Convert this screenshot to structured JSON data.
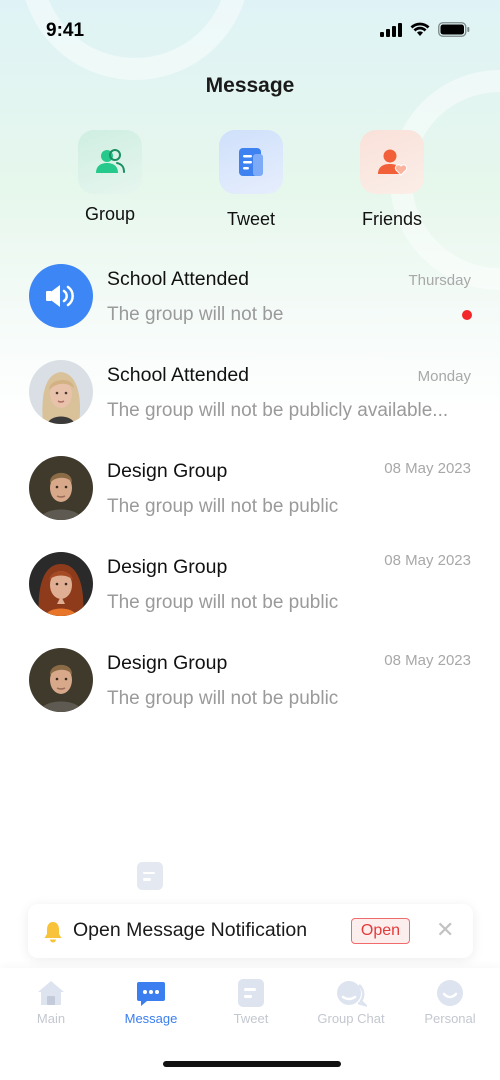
{
  "status": {
    "time": "9:41"
  },
  "header": {
    "title": "Message"
  },
  "quick_actions": [
    {
      "label": "Group",
      "icon": "group-icon",
      "color": "#2ecf8e"
    },
    {
      "label": "Tweet",
      "icon": "document-icon",
      "color": "#4a8af4"
    },
    {
      "label": "Friends",
      "icon": "friend-heart-icon",
      "color": "#f46a4a"
    }
  ],
  "messages": [
    {
      "name": "School Attended",
      "preview": "The group will not be",
      "time": "Thursday",
      "unread": true,
      "avatar": "speaker-icon"
    },
    {
      "name": "School Attended",
      "preview": "The group will not be publicly available...",
      "time": "Monday",
      "unread": false,
      "avatar": "blonde-woman-avatar"
    },
    {
      "name": "Design Group",
      "preview": "The group will not be public",
      "time": "08 May 2023",
      "unread": false,
      "avatar": "man-avatar"
    },
    {
      "name": "Design Group",
      "preview": "The group will not be public",
      "time": "08 May 2023",
      "unread": false,
      "avatar": "redhead-woman-avatar"
    },
    {
      "name": "Design Group",
      "preview": "The group will not be public",
      "time": "08 May 2023",
      "unread": false,
      "avatar": "man-avatar"
    }
  ],
  "notification": {
    "text": "Open Message Notification",
    "action": "Open",
    "close": "✕"
  },
  "tabs": [
    {
      "label": "Main",
      "icon": "home-icon",
      "active": false
    },
    {
      "label": "Message",
      "icon": "message-icon",
      "active": true
    },
    {
      "label": "Tweet",
      "icon": "document-icon",
      "active": false
    },
    {
      "label": "Group Chat",
      "icon": "group-chat-icon",
      "active": false
    },
    {
      "label": "Personal",
      "icon": "personal-icon",
      "active": false
    }
  ],
  "colors": {
    "accent": "#3a7ef0",
    "unread": "#f2262b",
    "inactive_tab": "#c3c7cf"
  }
}
